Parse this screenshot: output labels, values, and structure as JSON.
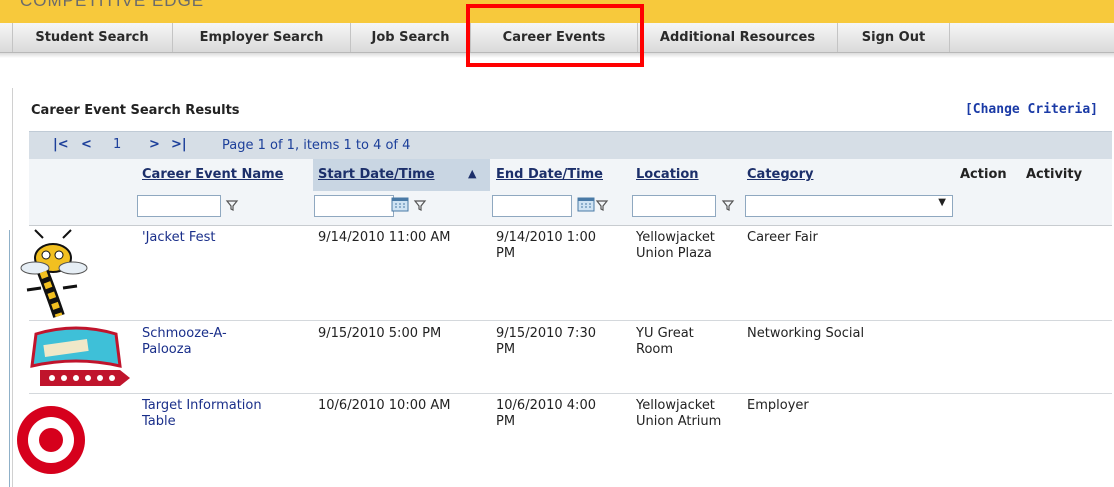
{
  "brand": {
    "text": "COMPETITIVE EDGE"
  },
  "nav": {
    "items": [
      {
        "label": "Student Search"
      },
      {
        "label": "Employer Search"
      },
      {
        "label": "Job Search"
      },
      {
        "label": "Career Events"
      },
      {
        "label": "Additional Resources"
      },
      {
        "label": "Sign Out"
      }
    ],
    "highlighted_item": "Career Events",
    "highlight_color": "#ff0000"
  },
  "results": {
    "title": "Career Event Search Results",
    "change_criteria": "[Change Criteria]",
    "pager": {
      "first": "|<",
      "prev": "<",
      "current_page": "1",
      "next": ">",
      "last": ">|",
      "summary": "Page 1 of 1, items 1 to 4 of 4"
    },
    "columns": {
      "name": "Career Event Name",
      "start": "Start Date/Time",
      "start_sort": "▲",
      "end": "End Date/Time",
      "location": "Location",
      "category": "Category",
      "action": "Action",
      "activity": "Activity"
    },
    "filters": {
      "name": "",
      "start": "",
      "end": "",
      "location": "",
      "category": ""
    },
    "rows": [
      {
        "name": "'Jacket Fest",
        "start": "9/14/2010 11:00 AM",
        "end": "9/14/2010 1:00 PM",
        "location": "Yellowjacket Union Plaza",
        "category": "Career Fair",
        "image": "yellowjacket-mascot"
      },
      {
        "name": "Schmooze-A-Palooza",
        "start": "9/15/2010 5:00 PM",
        "end": "9/15/2010 7:30 PM",
        "location": "YU Great Room",
        "category": "Networking Social",
        "image": "schmooze-sign-logo"
      },
      {
        "name": "Target Information Table",
        "start": "10/6/2010 10:00 AM",
        "end": "10/6/2010 4:00 PM",
        "location": "Yellowjacket Union Atrium",
        "category": "Employer",
        "image": "target-logo"
      }
    ]
  },
  "colors": {
    "accent_link": "#1a2f8a",
    "header_bg": "#f2f5f8",
    "pager_bg": "#d6dee6",
    "brand_band": "#f7c93c"
  }
}
